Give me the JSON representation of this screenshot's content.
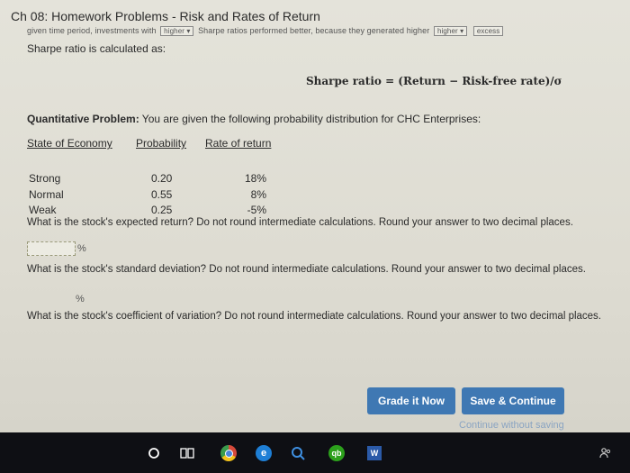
{
  "page": {
    "title": "Ch 08: Homework Problems - Risk and Rates of Return",
    "cutoff_line": {
      "part1": "given time period, investments with",
      "box1": "higher",
      "part2": "Sharpe ratios performed better, because they generated higher",
      "box2": "higher",
      "part3": "excess"
    },
    "sharpe_lead": "Sharpe ratio is calculated as:",
    "formula": "Sharpe ratio = (Return − Risk-free rate)/σ",
    "quant_label": "Quantitative Problem:",
    "quant_text": " You are given the following probability distribution for CHC Enterprises:"
  },
  "table": {
    "headers": [
      "State of Economy",
      "Probability",
      "Rate of return"
    ],
    "rows": [
      {
        "state": "Strong",
        "prob": "0.20",
        "rate": "18%"
      },
      {
        "state": "Normal",
        "prob": "0.55",
        "rate": "8%"
      },
      {
        "state": "Weak",
        "prob": "0.25",
        "rate": "-5%"
      }
    ]
  },
  "questions": [
    {
      "text": "What is the stock's expected return? Do not round intermediate calculations. Round your answer to two decimal places.",
      "unit": "%"
    },
    {
      "text": "What is the stock's standard deviation? Do not round intermediate calculations. Round your answer to two decimal places.",
      "unit": "%"
    },
    {
      "text": "What is the stock's coefficient of variation? Do not round intermediate calculations. Round your answer to two decimal places."
    }
  ],
  "buttons": {
    "grade": "Grade it Now",
    "save": "Save & Continue",
    "continue": "Continue without saving"
  },
  "taskbar": {
    "qb_label": "qb",
    "word_label": "W"
  },
  "colors": {
    "button": "#3f78b3",
    "taskbar": "#0e0f14"
  }
}
